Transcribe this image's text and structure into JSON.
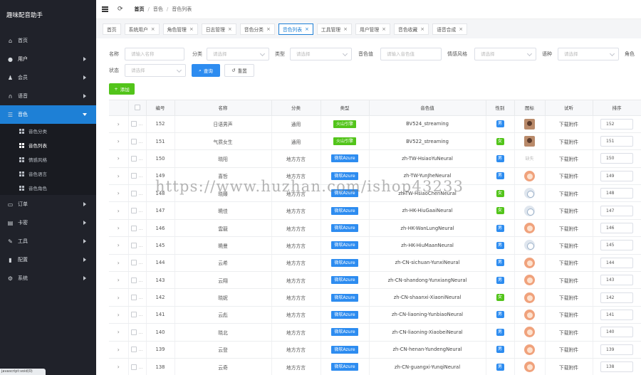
{
  "app": {
    "brand": "趣味配音助手"
  },
  "colors": {
    "sidebar_bg": "#20222a",
    "active_blue": "#1e80d6",
    "primary": "#2d8cf0",
    "green_add": "#52c41a",
    "badge_volc": "#52c41a",
    "badge_azure": "#2d8cf0",
    "gender_male": "#2d8cf0",
    "gender_female": "#52c41a"
  },
  "sidebar": {
    "items": [
      {
        "label": "首页",
        "icon": "home-icon",
        "arrow": false
      },
      {
        "label": "用户",
        "icon": "user-icon",
        "arrow": true
      },
      {
        "label": "会员",
        "icon": "member-icon",
        "arrow": true
      },
      {
        "label": "语音",
        "icon": "headphone-icon",
        "arrow": true
      },
      {
        "label": "音色",
        "icon": "list-icon",
        "arrow": true,
        "active": true
      },
      {
        "label": "订单",
        "icon": "order-icon",
        "arrow": true
      },
      {
        "label": "卡密",
        "icon": "card-icon",
        "arrow": true
      },
      {
        "label": "工具",
        "icon": "wrench-icon",
        "arrow": true
      },
      {
        "label": "配置",
        "icon": "chart-icon",
        "arrow": true
      },
      {
        "label": "系统",
        "icon": "gear-icon",
        "arrow": true
      }
    ],
    "sub_items": [
      "音色分类",
      "音色列表",
      "情感风格",
      "音色语言",
      "音色角色"
    ],
    "status_tip": "javascript:void(0)"
  },
  "header": {
    "breadcrumb": [
      "首页",
      "音色",
      "音色列表"
    ]
  },
  "tabs": [
    {
      "label": "首页",
      "closable": false
    },
    {
      "label": "系统用户",
      "closable": true
    },
    {
      "label": "角色管理",
      "closable": true
    },
    {
      "label": "日志管理",
      "closable": true
    },
    {
      "label": "音色分类",
      "closable": true
    },
    {
      "label": "音色列表",
      "closable": true,
      "active": true
    },
    {
      "label": "工具管理",
      "closable": true
    },
    {
      "label": "用户管理",
      "closable": true
    },
    {
      "label": "音色收藏",
      "closable": true
    },
    {
      "label": "语音合成",
      "closable": true
    }
  ],
  "filters": {
    "name_label": "名称",
    "name_placeholder": "请输入名称",
    "category_label": "分类",
    "category_placeholder": "请选择",
    "type_label": "类型",
    "type_placeholder": "请选择",
    "voice_label": "音色值",
    "voice_placeholder": "请输入音色值",
    "emotion_label": "情感风格",
    "emotion_placeholder": "请选择",
    "lang_label": "语种",
    "lang_placeholder": "请选择",
    "role_label": "角色",
    "status_label": "状态",
    "status_placeholder": "请选择",
    "search_button": "查询",
    "reset_button": "重置",
    "add_button": "添加"
  },
  "table": {
    "headers": [
      "",
      "",
      "编号",
      "名称",
      "分类",
      "类型",
      "音色值",
      "性别",
      "图标",
      "试听",
      "排序"
    ],
    "rows": [
      {
        "id": "152",
        "name": "日语男声",
        "category": "通用",
        "type": "火山引擎",
        "voice": "BV524_streaming",
        "gender": "男",
        "avatar": "photo",
        "listen": "下载附件",
        "sort": "152"
      },
      {
        "id": "151",
        "name": "气质女生",
        "category": "通用",
        "type": "火山引擎",
        "voice": "BV522_streaming",
        "gender": "女",
        "avatar": "photo",
        "listen": "下载附件",
        "sort": "151"
      },
      {
        "id": "150",
        "name": "晓阳",
        "category": "地方方言",
        "type": "微软Azure",
        "voice": "zh-TW-HsiaoYuNeural",
        "gender": "男",
        "avatar": "missing",
        "avatar_text": "缺失",
        "listen": "下载附件",
        "sort": "150"
      },
      {
        "id": "149",
        "name": "喜哲",
        "category": "地方方言",
        "type": "微软Azure",
        "voice": "zh-TW-YunJheNeural",
        "gender": "男",
        "avatar": "girl",
        "listen": "下载附件",
        "sort": "149"
      },
      {
        "id": "148",
        "name": "晓臻",
        "category": "地方方言",
        "type": "微软Azure",
        "voice": "zh-TW-HsiaoChenNeural",
        "gender": "女",
        "avatar": "boy",
        "listen": "下载附件",
        "sort": "148"
      },
      {
        "id": "147",
        "name": "曉佳",
        "category": "地方方言",
        "type": "微软Azure",
        "voice": "zh-HK-HiuGaaiNeural",
        "gender": "女",
        "avatar": "boy",
        "listen": "下载附件",
        "sort": "147"
      },
      {
        "id": "146",
        "name": "雲龍",
        "category": "地方方言",
        "type": "微软Azure",
        "voice": "zh-HK-WanLungNeural",
        "gender": "男",
        "avatar": "girl",
        "listen": "下载附件",
        "sort": "146"
      },
      {
        "id": "145",
        "name": "曉曼",
        "category": "地方方言",
        "type": "微软Azure",
        "voice": "zh-HK-HiuMaanNeural",
        "gender": "男",
        "avatar": "boy",
        "listen": "下载附件",
        "sort": "145"
      },
      {
        "id": "144",
        "name": "云希",
        "category": "地方方言",
        "type": "微软Azure",
        "voice": "zh-CN-sichuan-YunxiNeural",
        "gender": "男",
        "avatar": "girl",
        "listen": "下载附件",
        "sort": "144"
      },
      {
        "id": "143",
        "name": "云翔",
        "category": "地方方言",
        "type": "微软Azure",
        "voice": "zh-CN-shandong-YunxiangNeural",
        "gender": "男",
        "avatar": "girl",
        "listen": "下载附件",
        "sort": "143"
      },
      {
        "id": "142",
        "name": "晓妮",
        "category": "地方方言",
        "type": "微软Azure",
        "voice": "zh-CN-shaanxi-XiaoniNeural",
        "gender": "女",
        "avatar": "girl",
        "listen": "下载附件",
        "sort": "142"
      },
      {
        "id": "141",
        "name": "云彪",
        "category": "地方方言",
        "type": "微软Azure",
        "voice": "zh-CN-liaoning-YunbiaoNeural",
        "gender": "男",
        "avatar": "girl",
        "listen": "下载附件",
        "sort": "141"
      },
      {
        "id": "140",
        "name": "晓北",
        "category": "地方方言",
        "type": "微软Azure",
        "voice": "zh-CN-liaoning-XiaobeiNeural",
        "gender": "男",
        "avatar": "girl",
        "listen": "下载附件",
        "sort": "140"
      },
      {
        "id": "139",
        "name": "云登",
        "category": "地方方言",
        "type": "微软Azure",
        "voice": "zh-CN-henan-YundengNeural",
        "gender": "男",
        "avatar": "girl",
        "listen": "下载附件",
        "sort": "139"
      },
      {
        "id": "138",
        "name": "云奇",
        "category": "地方方言",
        "type": "微软Azure",
        "voice": "zh-CN-guangxi-YunqiNeural",
        "gender": "男",
        "avatar": "girl",
        "listen": "下载附件",
        "sort": "138"
      }
    ]
  },
  "watermark": "https://www.huzhan.com/ishop43233"
}
